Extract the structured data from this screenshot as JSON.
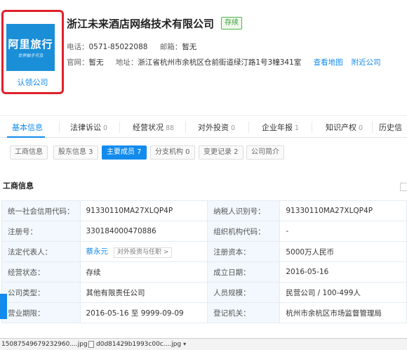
{
  "logo": {
    "main_text": "阿里旅行",
    "sub_text": "世界触手可及",
    "claim_label": "认领公司"
  },
  "company": {
    "name": "浙江未来酒店网络技术有限公司",
    "status": "存续"
  },
  "contact": {
    "phone_label": "电话：",
    "phone": "0571-85022088",
    "email_label": "邮箱：",
    "email": "暂无",
    "website_label": "官网：",
    "website": "暂无",
    "address_label": "地址：",
    "address": "浙江省杭州市余杭区仓前街道绿汀路1号3幢341室",
    "map_link": "查看地图",
    "nearby_link": "附近公司"
  },
  "tabs": [
    {
      "label": "基本信息",
      "count": ""
    },
    {
      "label": "法律诉讼",
      "count": "0"
    },
    {
      "label": "经营状况",
      "count": "88"
    },
    {
      "label": "对外投资",
      "count": "0"
    },
    {
      "label": "企业年报",
      "count": "1"
    },
    {
      "label": "知识产权",
      "count": "0"
    },
    {
      "label": "历史信",
      "count": ""
    }
  ],
  "subtabs": [
    {
      "label": "工商信息"
    },
    {
      "label": "股东信息 3"
    },
    {
      "label": "主要成员 7"
    },
    {
      "label": "分支机构 0"
    },
    {
      "label": "变更记录 2"
    },
    {
      "label": "公司简介"
    }
  ],
  "section_title": "工商信息",
  "table": [
    {
      "k1": "统一社会信用代码：",
      "v1": "91330110MA27XLQP4P",
      "k2": "纳税人识别号：",
      "v2": "91330110MA27XLQP4P"
    },
    {
      "k1": "注册号：",
      "v1": "330184000470886",
      "k2": "组织机构代码：",
      "v2": "-"
    },
    {
      "k1": "法定代表人：",
      "v1": "蔡永元",
      "v1_link": "对外投资与任职 >",
      "k2": "注册资本：",
      "v2": "5000万人民币"
    },
    {
      "k1": "经营状态：",
      "v1": "存续",
      "k2": "成立日期：",
      "v2": "2016-05-16"
    },
    {
      "k1": "公司类型：",
      "v1": "其他有限责任公司",
      "k2": "人员规模：",
      "v2": "民营公司 / 100-499人"
    },
    {
      "k1": "营业期限：",
      "v1": "2016-05-16 至 9999-09-09",
      "k2": "登记机关：",
      "v2": "杭州市余杭区市场监督管理局"
    }
  ],
  "downloads": [
    {
      "name": "15087549679232960....jpg"
    },
    {
      "name": "d0d81429b1993c00c....jpg"
    }
  ],
  "colors": {
    "accent": "#128bed",
    "status_green": "#4fb44a",
    "highlight_red": "#e0202a"
  }
}
